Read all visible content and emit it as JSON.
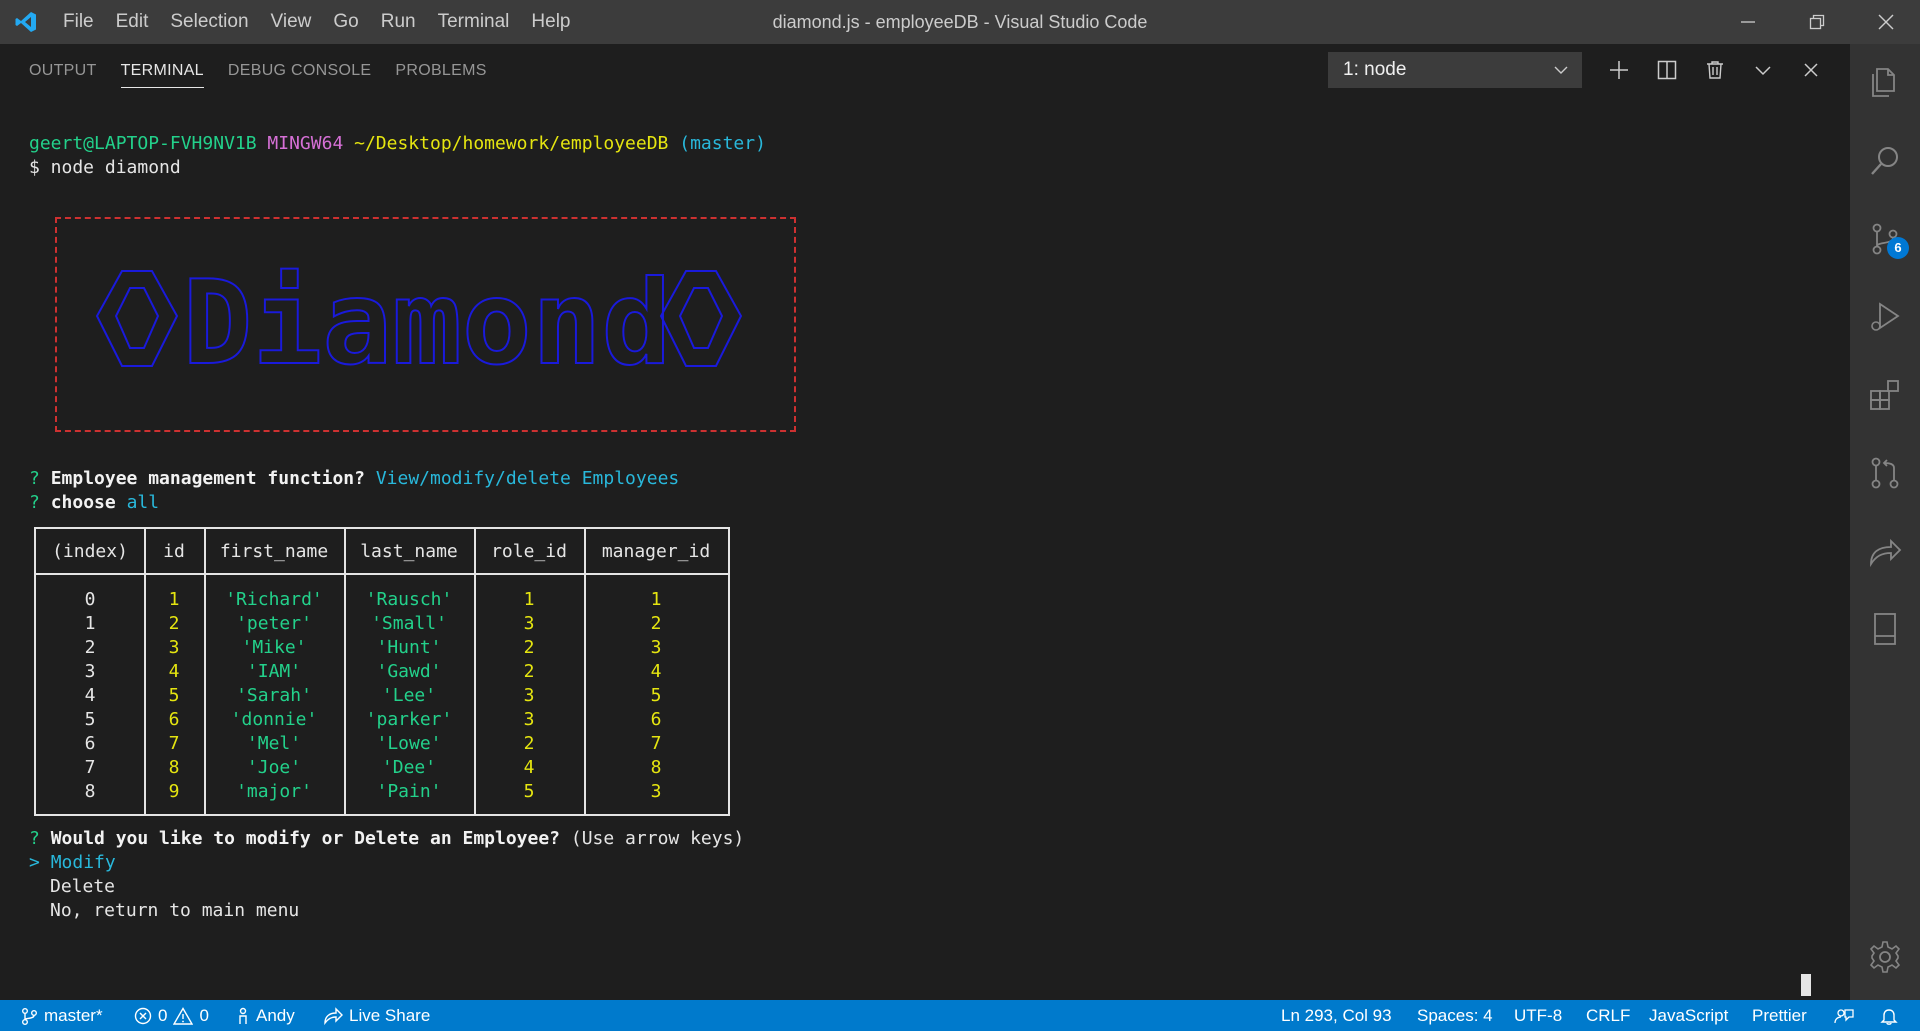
{
  "window": {
    "title": "diamond.js - employeeDB - Visual Studio Code",
    "menu": [
      "File",
      "Edit",
      "Selection",
      "View",
      "Go",
      "Run",
      "Terminal",
      "Help"
    ]
  },
  "panel": {
    "tabs": [
      "OUTPUT",
      "TERMINAL",
      "DEBUG CONSOLE",
      "PROBLEMS"
    ],
    "active_tab": "TERMINAL",
    "terminal_select": "1: node"
  },
  "terminal": {
    "prompt_user": "geert@LAPTOP-FVH9NV1B",
    "prompt_shell": "MINGW64",
    "prompt_path": "~/Desktop/homework/employeeDB",
    "prompt_branch": "(master)",
    "command": "$ node diamond",
    "banner_text": "Diamond",
    "q1_mark": "?",
    "q1_text": "Employee management function?",
    "q1_answer": "View/modify/delete Employees",
    "q2_mark": "?",
    "q2_text": "choose",
    "q2_answer": "all",
    "table": {
      "headers": [
        "(index)",
        "id",
        "first_name",
        "last_name",
        "role_id",
        "manager_id"
      ],
      "rows": [
        [
          "0",
          "1",
          "'Richard'",
          "'Rausch'",
          "1",
          "1"
        ],
        [
          "1",
          "2",
          "'peter'",
          "'Small'",
          "3",
          "2"
        ],
        [
          "2",
          "3",
          "'Mike'",
          "'Hunt'",
          "2",
          "3"
        ],
        [
          "3",
          "4",
          "'IAM'",
          "'Gawd'",
          "2",
          "4"
        ],
        [
          "4",
          "5",
          "'Sarah'",
          "'Lee'",
          "3",
          "5"
        ],
        [
          "5",
          "6",
          "'donnie'",
          "'parker'",
          "3",
          "6"
        ],
        [
          "6",
          "7",
          "'Mel'",
          "'Lowe'",
          "2",
          "7"
        ],
        [
          "7",
          "8",
          "'Joe'",
          "'Dee'",
          "4",
          "8"
        ],
        [
          "8",
          "9",
          "'major'",
          "'Pain'",
          "5",
          "3"
        ]
      ]
    },
    "q3_mark": "?",
    "q3_text": "Would you like to modify or Delete an Employee?",
    "q3_hint": "(Use arrow keys)",
    "choices": {
      "pointer": ">",
      "selected": "Modify",
      "other1": "Delete",
      "other2": "No, return to main menu"
    }
  },
  "activity_bar": {
    "icons": [
      "explorer-icon",
      "search-icon",
      "source-control-icon",
      "run-debug-icon",
      "extensions-icon",
      "pull-requests-icon",
      "live-share-icon",
      "notebook-icon",
      "settings-gear-icon"
    ],
    "source_control_badge": "6"
  },
  "status_bar": {
    "branch": "master*",
    "errors": "0",
    "warnings": "0",
    "user": "Andy",
    "live_share": "Live Share",
    "position": "Ln 293, Col 93",
    "spaces": "Spaces: 4",
    "encoding": "UTF-8",
    "eol": "CRLF",
    "language": "JavaScript",
    "formatter": "Prettier"
  },
  "colors": {
    "status_bar": "#007acc",
    "title_bar": "#3c3c3c",
    "activity_bar": "#333333",
    "terminal_bg": "#1e1e1e",
    "banner_border": "#cd3131",
    "banner_text": "#1a1adb",
    "green": "#23d18b",
    "yellow": "#e5e510",
    "cyan": "#29b8db",
    "magenta": "#d670d6"
  }
}
